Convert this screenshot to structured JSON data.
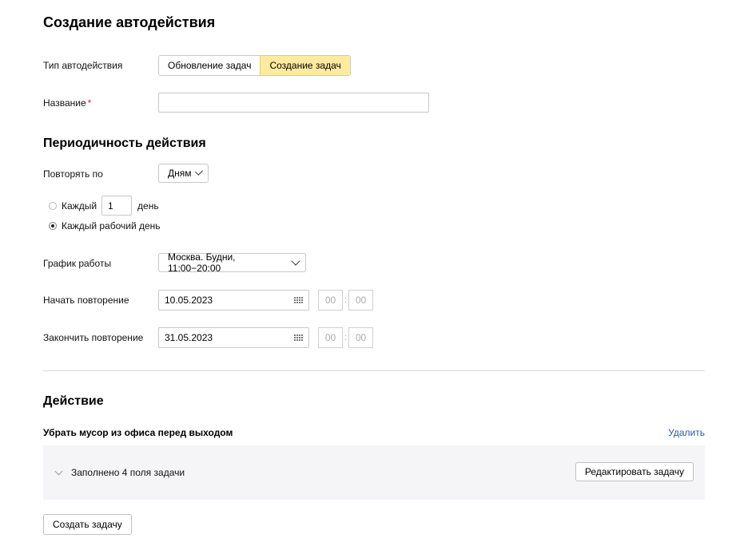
{
  "page": {
    "title": "Создание автодействия"
  },
  "type_field": {
    "label": "Тип автодействия",
    "options": [
      "Обновление задач",
      "Создание задач"
    ],
    "selected": "Создание задач"
  },
  "name_field": {
    "label": "Название",
    "required_mark": "*",
    "value": ""
  },
  "periodicity": {
    "heading": "Периодичность действия",
    "repeat_label": "Повторять по",
    "repeat_value": "Дням",
    "every_label": "Каждый",
    "every_value": "1",
    "every_unit": "день",
    "workday_label": "Каждый рабочий день",
    "selected_option": "workday",
    "schedule_label": "График работы",
    "schedule_value": "Москва. Будни, 11:00−20:00",
    "start_label": "Начать повторение",
    "start_date": "10.05.2023",
    "start_hour": "00",
    "start_minute": "00",
    "end_label": "Закончить повторение",
    "end_date": "31.05.2023",
    "end_hour": "00",
    "end_minute": "00",
    "time_separator": ":"
  },
  "action": {
    "heading": "Действие",
    "task_title": "Убрать мусор из офиса перед выходом",
    "delete_label": "Удалить",
    "summary": "Заполнено 4 поля задачи",
    "edit_button": "Редактировать задачу",
    "create_button": "Создать задачу"
  },
  "colors": {
    "accent_selected": "#ffeba0",
    "link": "#2a5aa8",
    "required": "#d22222",
    "panel_bg": "#f5f5f7"
  }
}
